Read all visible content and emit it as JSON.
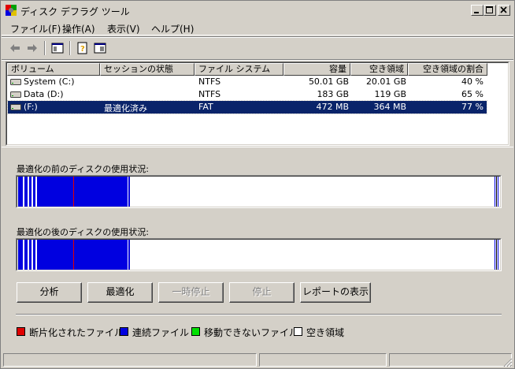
{
  "window": {
    "title": "ディスク デフラグ ツール"
  },
  "menu": [
    "ファイル(F)",
    "操作(A)",
    "表示(V)",
    "ヘルプ(H)"
  ],
  "columns": [
    "ボリューム",
    "セッションの状態",
    "ファイル システム",
    "容量",
    "空き領域",
    "空き領域の割合"
  ],
  "volumes": [
    {
      "name": "System (C:)",
      "status": "",
      "fs": "NTFS",
      "capacity": "50.01 GB",
      "free": "20.01 GB",
      "pct": "40 %"
    },
    {
      "name": "Data (D:)",
      "status": "",
      "fs": "NTFS",
      "capacity": "183 GB",
      "free": "119 GB",
      "pct": "65 %"
    },
    {
      "name": "(F:)",
      "status": "最適化済み",
      "fs": "FAT",
      "capacity": "472 MB",
      "free": "364 MB",
      "pct": "77 %"
    }
  ],
  "panel": {
    "before_label": "最適化の前のディスクの使用状況:",
    "after_label": "最適化の後のディスクの使用状況:"
  },
  "buttons": {
    "analyze": "分析",
    "defragment": "最適化",
    "pause": "一時停止",
    "stop": "停止",
    "report": "レポートの表示"
  },
  "legend": [
    {
      "label": "断片化されたファイル",
      "color": "#e00000"
    },
    {
      "label": "連続ファイル",
      "color": "#0000e0"
    },
    {
      "label": "移動できないファイル",
      "color": "#00e000"
    },
    {
      "label": "空き領域",
      "color": "#ffffff"
    }
  ],
  "colors": {
    "selection": "#0a246a",
    "contiguous": "#0000e0",
    "fragmented": "#e00000",
    "background": "#d4d0c8"
  },
  "icons": [
    "app-defrag-icon",
    "back-arrow-icon",
    "forward-arrow-icon",
    "show-hide-console-tree-icon",
    "help-icon",
    "properties-icon",
    "drive-icon"
  ]
}
